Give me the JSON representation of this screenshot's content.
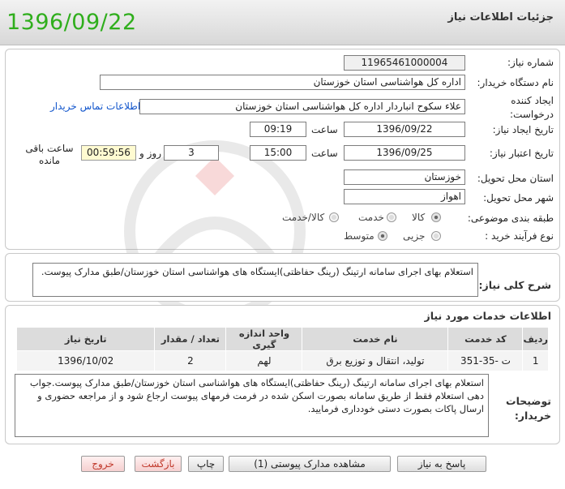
{
  "header": {
    "date": "1396/09/22",
    "title": "جزئیات اطلاعات نیاز"
  },
  "form": {
    "need_number_label": "شماره نیاز:",
    "need_number": "11965461000004",
    "buyer_org_label": "نام دستگاه خریدار:",
    "buyer_org": "اداره کل هواشناسی استان خوزستان",
    "creator_label": "ایجاد کننده درخواست:",
    "creator": "علاء سکوح انباردار اداره کل هواشناسی استان خوزستان",
    "contact_link": "اطلاعات تماس خریدار",
    "created_date_label": "تاریخ ایجاد نیاز:",
    "created_date": "1396/09/22",
    "time_label": "ساعت",
    "created_time": "09:19",
    "validity_label": "تاریخ اعتبار نیاز:",
    "validity_date": "1396/09/25",
    "validity_time": "15:00",
    "days": "3",
    "days_label": "روز و",
    "remaining_time": "00:59:56",
    "remaining_label": "ساعت باقی مانده",
    "province_label": "استان محل تحویل:",
    "province": "خوزستان",
    "city_label": "شهر محل تحویل:",
    "city": "اهواز",
    "category_label": "طبقه بندی موضوعی:",
    "category_options": [
      "کالا",
      "خدمت",
      "کالا/خدمت"
    ],
    "process_label": "نوع فرآیند خرید :",
    "process_options": [
      "جزیی",
      "متوسط"
    ]
  },
  "summary": {
    "label": "شرح کلی نیاز:",
    "text": "استعلام بهای اجرای سامانه ارتینگ (رینگ حفاظتی)ایستگاه های هواشناسی استان خوزستان/طبق مدارک پیوست."
  },
  "services": {
    "title": "اطلاعات خدمات مورد نیاز",
    "columns": [
      "ردیف",
      "کد خدمت",
      "نام خدمت",
      "واحد اندازه گیری",
      "تعداد / مقدار",
      "تاریخ نیاز"
    ],
    "rows": [
      [
        "1",
        "ت -35-351",
        "تولید، انتقال و توزیع برق",
        "لهم",
        "2",
        "1396/10/02"
      ]
    ]
  },
  "buyer_notes": {
    "label": "توضیحات خریدار:",
    "text": "استعلام بهای اجرای سامانه ارتینگ (رینگ حفاظتی)ایستگاه های هواشناسی استان خوزستان/طبق مدارک پیوست.جواب دهی استعلام فقط از طریق سامانه بصورت اسکن شده در فرمت فرمهای پیوست ارجاع شود و از مراجعه حضوری و ارسال پاکات بصورت دستی خودداری فرمایید."
  },
  "buttons": {
    "reply": "پاسخ به نیاز",
    "attachments": "مشاهده مدارک پیوستی (1)",
    "print": "چاپ",
    "back": "بازگشت",
    "exit": "خروج"
  },
  "colors": {
    "date_green": "#2fae1c",
    "link_blue": "#1155cc",
    "timer_bg": "#fffbd1"
  }
}
